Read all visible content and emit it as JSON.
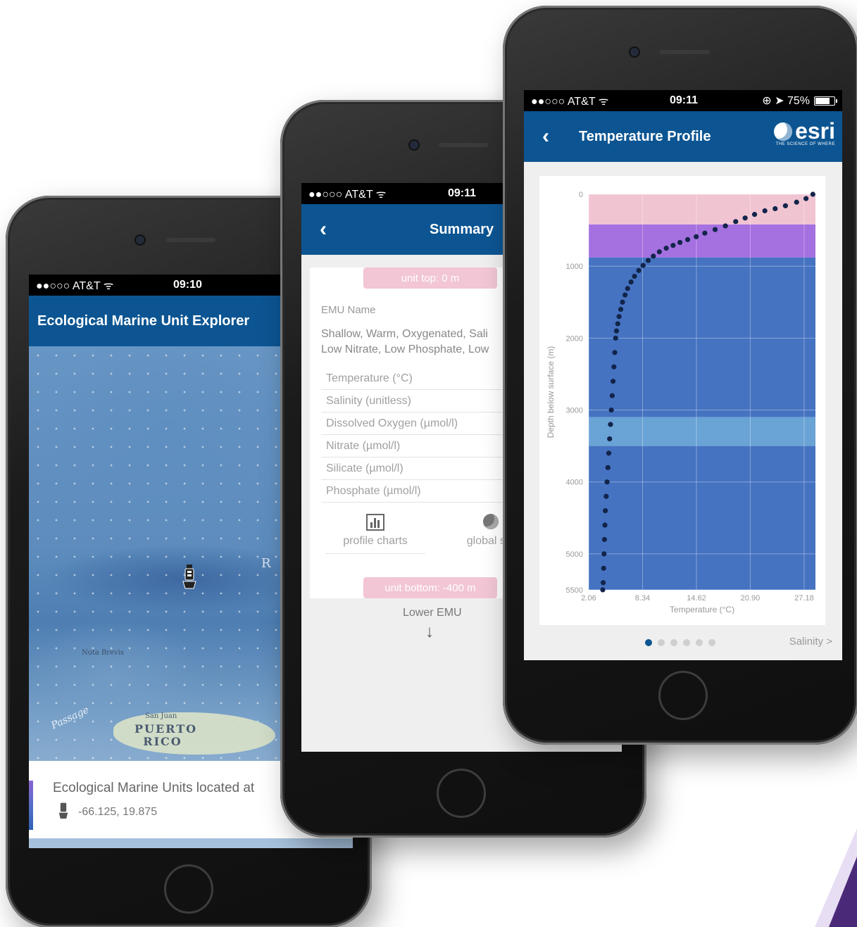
{
  "phone_left": {
    "status": {
      "carrier": "●●○○○ AT&T ᯤ",
      "time": "09:10"
    },
    "title": "Ecological Marine Unit Explorer",
    "map_labels": {
      "region": "PUERTO RICO",
      "passage": "Passage",
      "place": "San Juan",
      "rise": "Nota Brevis",
      "trench": "R"
    },
    "info": {
      "heading": "Ecological Marine Units located at",
      "coords": "-66.125, 19.875"
    }
  },
  "phone_middle": {
    "status": {
      "carrier": "●●○○○ AT&T ᯤ",
      "time": "09:11"
    },
    "title": "Summary",
    "unit_top": "unit top: 0 m",
    "emu_name_label": "EMU Name",
    "emu_name_value": "Shallow, Warm, Oxygenated, Sali Low Nitrate, Low Phosphate, Low",
    "rows": [
      "Temperature (°C)",
      "Salinity (unitless)",
      "Dissolved Oxygen (µmol/l)",
      "Nitrate (µmol/l)",
      "Silicate (µmol/l)",
      "Phosphate (µmol/l)"
    ],
    "actions": {
      "profile": "profile charts",
      "global": "global sta"
    },
    "unit_bottom": "unit bottom: -400 m",
    "lower": "Lower EMU"
  },
  "phone_right": {
    "status": {
      "carrier": "●●○○○ AT&T ᯤ",
      "time": "09:11",
      "battery": "⊕ ➤ 75%",
      "battery_level": 0.75
    },
    "title": "Temperature Profile",
    "logo": "esri",
    "logo_tag": "THE SCIENCE OF WHERE",
    "pagination": {
      "count": 6,
      "active": 0
    },
    "next_label": "Salinity  >"
  },
  "chart_data": {
    "type": "scatter",
    "title": "",
    "xlabel": "Temperature (°C)",
    "ylabel": "Depth below surface (m)",
    "xticks": [
      "2.06",
      "8.34",
      "14.62",
      "20.90",
      "27.18"
    ],
    "yticks": [
      "0",
      "1000",
      "2000",
      "3000",
      "4000",
      "5000",
      "5500"
    ],
    "xlim": [
      2.06,
      28.5
    ],
    "ylim": [
      0,
      5500
    ],
    "bands": [
      {
        "from": 0,
        "to": 420,
        "color": "#f1c4d2"
      },
      {
        "from": 420,
        "to": 880,
        "color": "#a570e0"
      },
      {
        "from": 880,
        "to": 3100,
        "color": "#4573c1"
      },
      {
        "from": 3100,
        "to": 3500,
        "color": "#6aa3d6"
      },
      {
        "from": 3500,
        "to": 5500,
        "color": "#4573c1"
      }
    ],
    "series": [
      {
        "points": [
          [
            28.2,
            0
          ],
          [
            27.4,
            60
          ],
          [
            26.3,
            110
          ],
          [
            25.0,
            160
          ],
          [
            23.8,
            200
          ],
          [
            22.6,
            230
          ],
          [
            21.4,
            280
          ],
          [
            20.3,
            330
          ],
          [
            19.2,
            380
          ],
          [
            18.0,
            440
          ],
          [
            16.8,
            490
          ],
          [
            15.6,
            540
          ],
          [
            14.6,
            590
          ],
          [
            13.6,
            630
          ],
          [
            12.7,
            670
          ],
          [
            11.9,
            710
          ],
          [
            11.1,
            750
          ],
          [
            10.3,
            800
          ],
          [
            9.6,
            860
          ],
          [
            9.0,
            920
          ],
          [
            8.4,
            990
          ],
          [
            7.9,
            1060
          ],
          [
            7.4,
            1140
          ],
          [
            7.0,
            1220
          ],
          [
            6.6,
            1310
          ],
          [
            6.3,
            1400
          ],
          [
            6.0,
            1500
          ],
          [
            5.8,
            1600
          ],
          [
            5.6,
            1700
          ],
          [
            5.45,
            1800
          ],
          [
            5.3,
            1900
          ],
          [
            5.2,
            2000
          ],
          [
            5.1,
            2200
          ],
          [
            5.0,
            2400
          ],
          [
            4.9,
            2600
          ],
          [
            4.8,
            2800
          ],
          [
            4.7,
            3000
          ],
          [
            4.6,
            3200
          ],
          [
            4.5,
            3400
          ],
          [
            4.4,
            3600
          ],
          [
            4.3,
            3800
          ],
          [
            4.2,
            4000
          ],
          [
            4.1,
            4200
          ],
          [
            4.0,
            4400
          ],
          [
            3.95,
            4600
          ],
          [
            3.9,
            4800
          ],
          [
            3.85,
            5000
          ],
          [
            3.8,
            5200
          ],
          [
            3.75,
            5400
          ],
          [
            3.7,
            5500
          ]
        ]
      }
    ]
  }
}
